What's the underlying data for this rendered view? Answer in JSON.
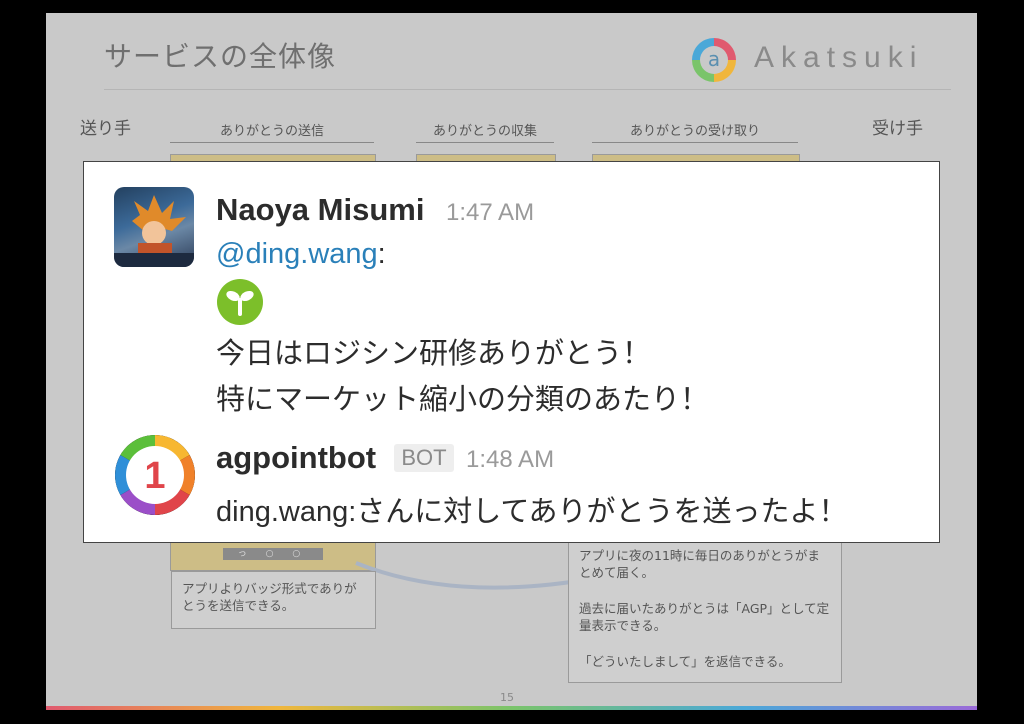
{
  "slide": {
    "title": "サービスの全体像",
    "logo_text": "Akatsuki",
    "logo_mark": "a",
    "sender_label": "送り手",
    "receiver_label": "受け手",
    "columns": [
      "ありがとうの送信",
      "ありがとうの収集",
      "ありがとうの受け取り"
    ],
    "device_bar": "っ ○ ○",
    "note_left": "アプリよりバッジ形式でありがとうを送信できる。",
    "note_right": [
      "アプリに夜の11時に毎日のありがとうがまとめて届く。",
      "過去に届いたありがとうは「AGP」として定量表示できる。",
      "「どういたしまして」を返信できる。"
    ],
    "page_number": "15"
  },
  "chat": {
    "messages": [
      {
        "sender": "Naoya Misumi",
        "time": "1:47 AM",
        "mention": "@ding.wang",
        "mention_suffix": ":",
        "emoji": "seedling-badge",
        "lines": [
          "今日はロジシン研修ありがとう！",
          "特にマーケット縮小の分類のあたり！"
        ]
      },
      {
        "sender": "agpointbot",
        "badge": "BOT",
        "time": "1:48 AM",
        "avatar_digit": "1",
        "text": "ding.wang:さんに対してありがとうを送ったよ！"
      }
    ]
  },
  "colors": {
    "mention": "#2a80b9",
    "slide_bg": "#c9c9c9",
    "emoji_green": "#7cbf2a"
  }
}
